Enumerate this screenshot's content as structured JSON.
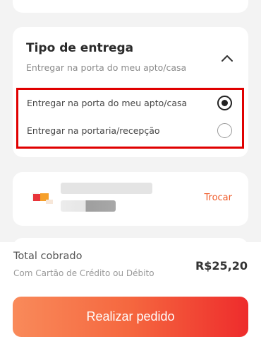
{
  "delivery": {
    "title": "Tipo de entrega",
    "subtitle": "Entregar na porta do meu apto/casa",
    "options": [
      {
        "label": "Entregar na porta do meu apto/casa",
        "selected": true
      },
      {
        "label": "Entregar na portaria/recepção",
        "selected": false
      }
    ]
  },
  "payment": {
    "change_label": "Trocar",
    "card_icon": "credit-card-brand-icon"
  },
  "summary": {
    "total_label": "Total cobrado",
    "payment_method": "Com Cartão de Crédito ou Débito",
    "total_value": "R$25,20"
  },
  "action": {
    "submit_label": "Realizar pedido"
  },
  "colors": {
    "accent": "#ef5a28",
    "highlight_border": "#e00000",
    "button_gradient_start": "#f98a5a",
    "button_gradient_end": "#ee2c2c"
  }
}
